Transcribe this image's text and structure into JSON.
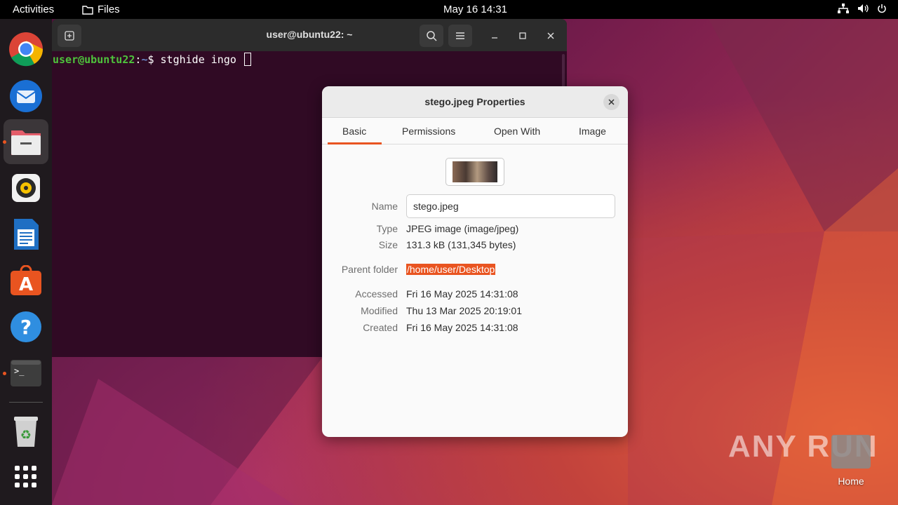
{
  "topbar": {
    "activities": "Activities",
    "app_name": "Files",
    "clock": "May 16  14:31"
  },
  "dock": {
    "items": [
      "Google Chrome",
      "Thunderbird Mail",
      "Files",
      "Rhythmbox",
      "LibreOffice Writer",
      "Ubuntu Software",
      "Help",
      "Terminal",
      "Trash",
      "Show Applications"
    ]
  },
  "terminal": {
    "title": "user@ubuntu22: ~",
    "prompt_user": "user@ubuntu22",
    "prompt_sep": ":",
    "prompt_path": "~",
    "prompt_symbol": "$ ",
    "command": "stghide ingo "
  },
  "dialog": {
    "title": "stego.jpeg Properties",
    "tabs": [
      "Basic",
      "Permissions",
      "Open With",
      "Image"
    ],
    "active_tab": "Basic",
    "fields": {
      "name_label": "Name",
      "name_value": "stego.jpeg",
      "type_label": "Type",
      "type_value": "JPEG image (image/jpeg)",
      "size_label": "Size",
      "size_value": "131.3 kB (131,345 bytes)",
      "parent_label": "Parent folder",
      "parent_value": "/home/user/Desktop",
      "accessed_label": "Accessed",
      "accessed_value": "Fri 16 May 2025 14:31:08",
      "modified_label": "Modified",
      "modified_value": "Thu 13 Mar 2025 20:19:01",
      "created_label": "Created",
      "created_value": "Fri 16 May 2025 14:31:08"
    }
  },
  "desktop": {
    "home_label": "Home",
    "watermark": "ANY RUN"
  },
  "colors": {
    "accent": "#e95420",
    "terminal_bg": "#300a24",
    "prompt_user": "#4ec23c",
    "prompt_path": "#6a88c9"
  }
}
